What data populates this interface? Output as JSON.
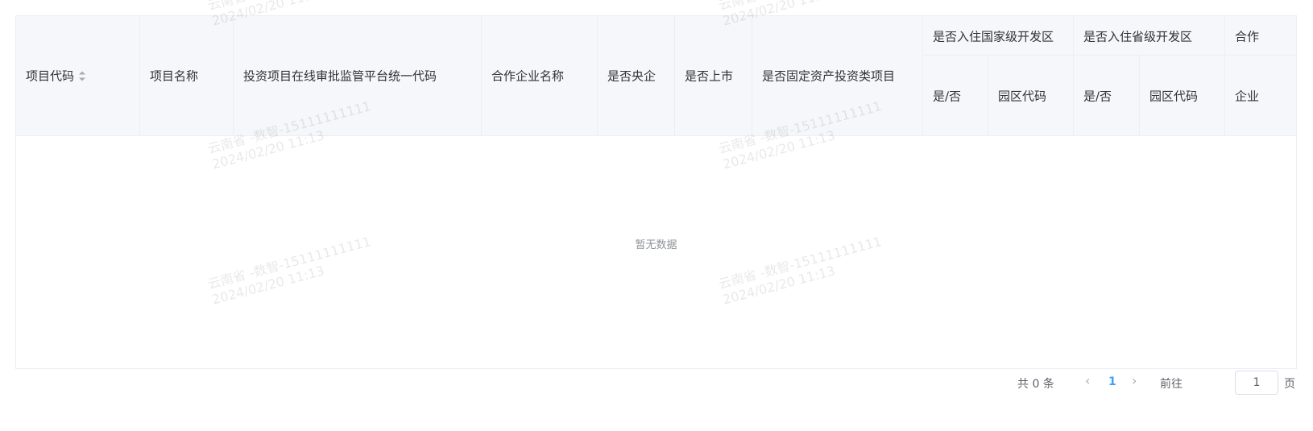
{
  "table": {
    "columns": [
      {
        "key": "code",
        "label": "项目代码",
        "sortable": true
      },
      {
        "key": "name",
        "label": "项目名称"
      },
      {
        "key": "platform_code",
        "label": "投资项目在线审批监管平台统一代码"
      },
      {
        "key": "partner",
        "label": "合作企业名称"
      },
      {
        "key": "central",
        "label": "是否央企"
      },
      {
        "key": "listed",
        "label": "是否上市"
      },
      {
        "key": "fixed_asset",
        "label": "是否固定资产投资类项目"
      }
    ],
    "groups": [
      {
        "label": "是否入住国家级开发区",
        "subs": [
          "是/否",
          "园区代码"
        ]
      },
      {
        "label": "是否入住省级开发区",
        "subs": [
          "是/否",
          "园区代码"
        ]
      },
      {
        "label": "合作",
        "subs": [
          "企业"
        ]
      }
    ],
    "empty_text": "暂无数据"
  },
  "pagination": {
    "total_text": "共 0 条",
    "current_page": "1",
    "goto_label": "前往",
    "goto_value": "1",
    "page_suffix": "页"
  },
  "watermark": {
    "line1": "云南省 -数智-15111111111",
    "line2": "2024/02/20 11:13"
  },
  "colors": {
    "accent": "#409eff",
    "header_bg": "#f5f7fa",
    "border": "#ebeef5"
  }
}
